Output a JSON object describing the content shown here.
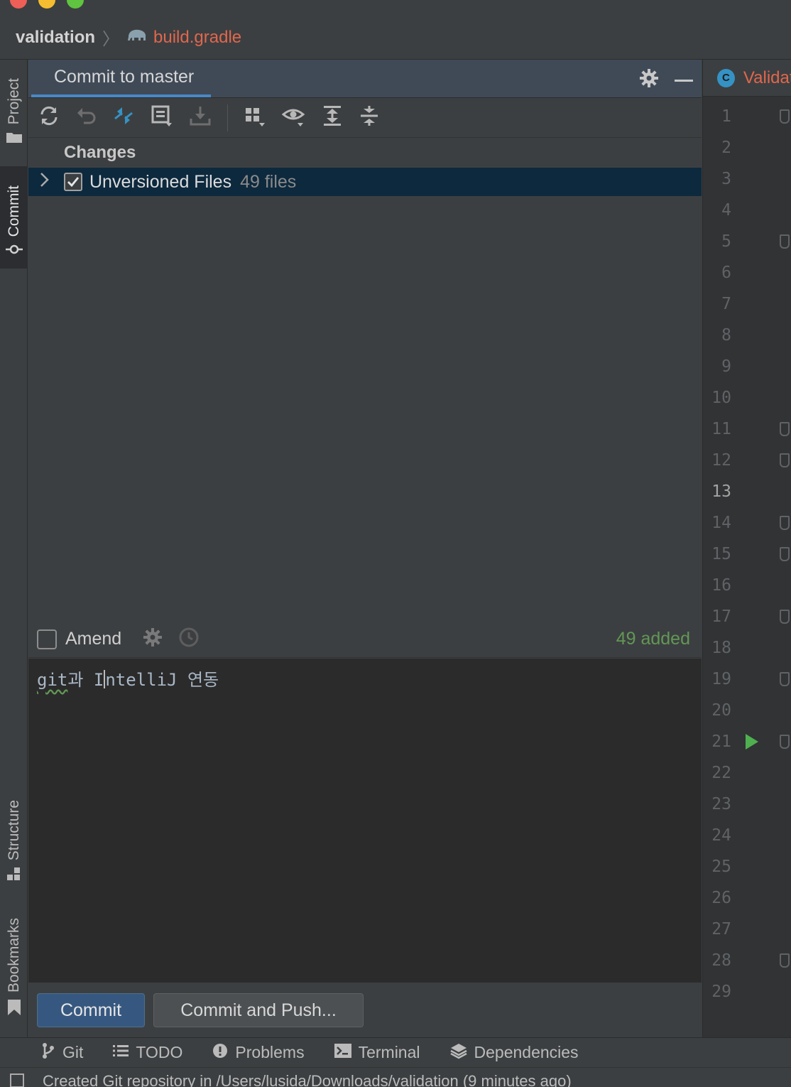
{
  "window": {
    "traffic_colors": [
      "#ee5f57",
      "#f5bd2f",
      "#5fc43f"
    ]
  },
  "breadcrumb": {
    "project": "validation",
    "file": "build.gradle"
  },
  "left_stripe": {
    "tabs": [
      {
        "label": "Project",
        "icon": "folder-icon",
        "active": false
      },
      {
        "label": "Commit",
        "icon": "commit-icon",
        "active": true
      },
      {
        "label": "Structure",
        "icon": "structure-icon",
        "active": false
      },
      {
        "label": "Bookmarks",
        "icon": "bookmark-icon",
        "active": false
      }
    ]
  },
  "commit_panel": {
    "title": "Commit to master",
    "toolbar_icons": [
      "refresh-icon",
      "rollback-icon",
      "show-diff-icon",
      "shelve-icon",
      "update-icon",
      "group-by-icon",
      "view-options-icon",
      "expand-all-icon",
      "collapse-all-icon"
    ],
    "changes_title": "Changes",
    "tree": [
      {
        "label": "Unversioned Files",
        "count": "49 files",
        "checked": true
      }
    ],
    "amend_label": "Amend",
    "added_summary": "49 added",
    "message_parts": {
      "p1": "git",
      "p2": "과 ",
      "p3": "I",
      "p4": "ntelliJ 연동"
    },
    "commit_button": "Commit",
    "commit_push_button": "Commit and Push..."
  },
  "editor_side": {
    "tab_icon_letter": "C",
    "tab_name": "Validat",
    "line_numbers": [
      "1",
      "2",
      "3",
      "4",
      "5",
      "6",
      "7",
      "8",
      "9",
      "10",
      "11",
      "12",
      "13",
      "14",
      "15",
      "16",
      "17",
      "18",
      "19",
      "20",
      "21",
      "22",
      "23",
      "24",
      "25",
      "26",
      "27",
      "28",
      "29"
    ],
    "current_line": "13",
    "run_line": "21",
    "fold_lines": [
      "1",
      "5",
      "11",
      "12",
      "14",
      "15",
      "17",
      "19",
      "21",
      "28"
    ]
  },
  "bottom_bar": {
    "items": [
      {
        "label": "Git",
        "icon": "git-branch-icon"
      },
      {
        "label": "TODO",
        "icon": "todo-list-icon"
      },
      {
        "label": "Problems",
        "icon": "problems-icon"
      },
      {
        "label": "Terminal",
        "icon": "terminal-icon"
      },
      {
        "label": "Dependencies",
        "icon": "dependencies-icon"
      }
    ]
  },
  "status_bar": {
    "message": "Created Git repository in /Users/lusida/Downloads/validation (9 minutes ago)"
  },
  "colors": {
    "accent": "#4a88c7",
    "selection": "#0d293e",
    "added_green": "#629755",
    "file_red": "#e0674d"
  }
}
